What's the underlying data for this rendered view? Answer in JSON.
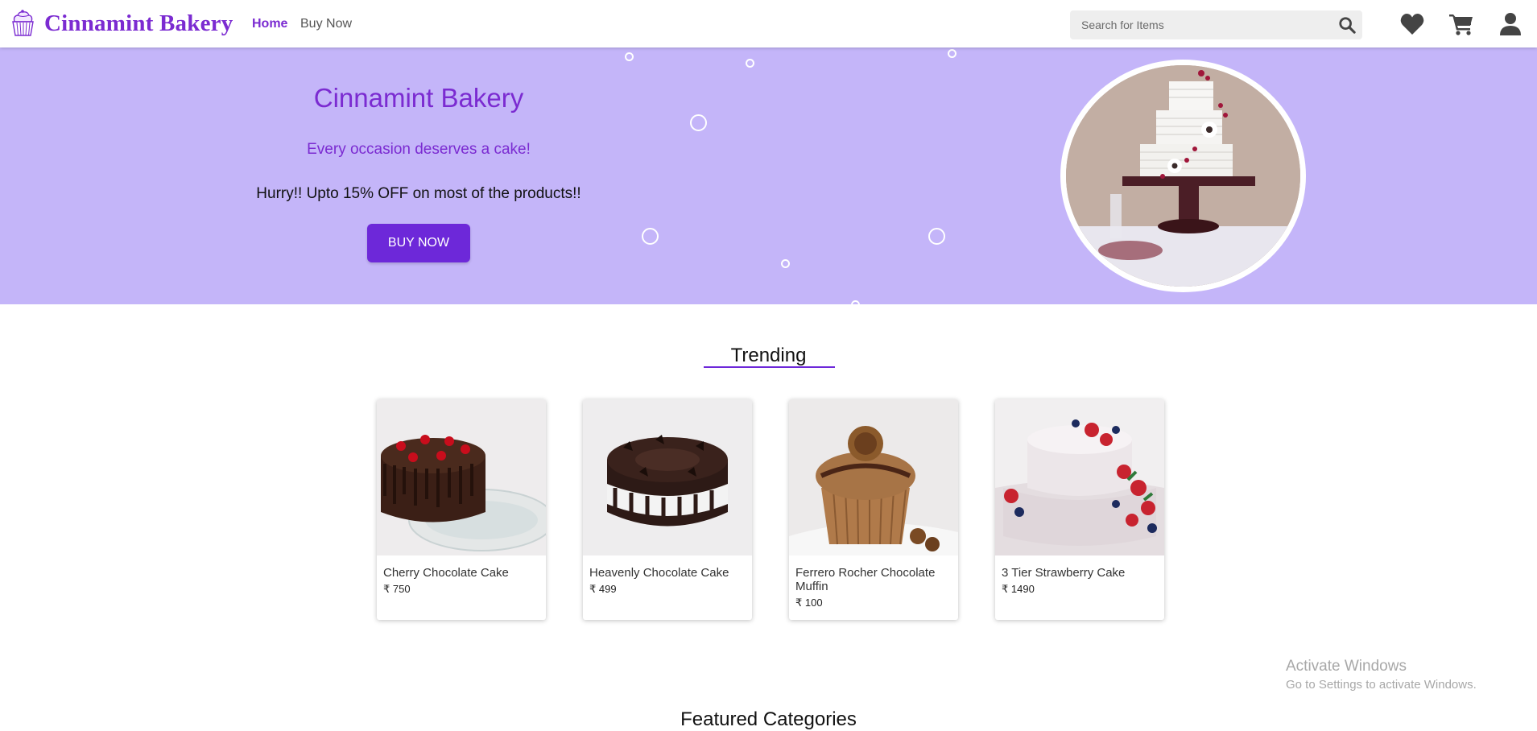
{
  "navbar": {
    "brand_name": "Cinnamint Bakery",
    "links": [
      {
        "label": "Home",
        "active": true
      },
      {
        "label": "Buy Now",
        "active": false
      }
    ],
    "search_placeholder": "Search for Items",
    "icons": [
      "search-icon",
      "heart-icon",
      "cart-icon",
      "user-icon"
    ]
  },
  "hero": {
    "title": "Cinnamint Bakery",
    "subtitle": "Every occasion deserves a cake!",
    "offer": "Hurry!! Upto 15% OFF on most of the products!!",
    "button_label": "BUY NOW"
  },
  "trending": {
    "title": "Trending",
    "products": [
      {
        "name": "Cherry Chocolate Cake",
        "price": "₹ 750"
      },
      {
        "name": "Heavenly Chocolate Cake",
        "price": "₹ 499"
      },
      {
        "name": "Ferrero Rocher Chocolate Muffin",
        "price": "₹ 100"
      },
      {
        "name": "3 Tier Strawberry Cake",
        "price": "₹ 1490"
      }
    ]
  },
  "featured": {
    "title": "Featured Categories"
  },
  "watermark": {
    "line1": "Activate Windows",
    "line2": "Go to Settings to activate Windows."
  },
  "colors": {
    "accent": "#7b2bd1",
    "button": "#6d28d9",
    "hero_bg": "#c4b5f9"
  }
}
